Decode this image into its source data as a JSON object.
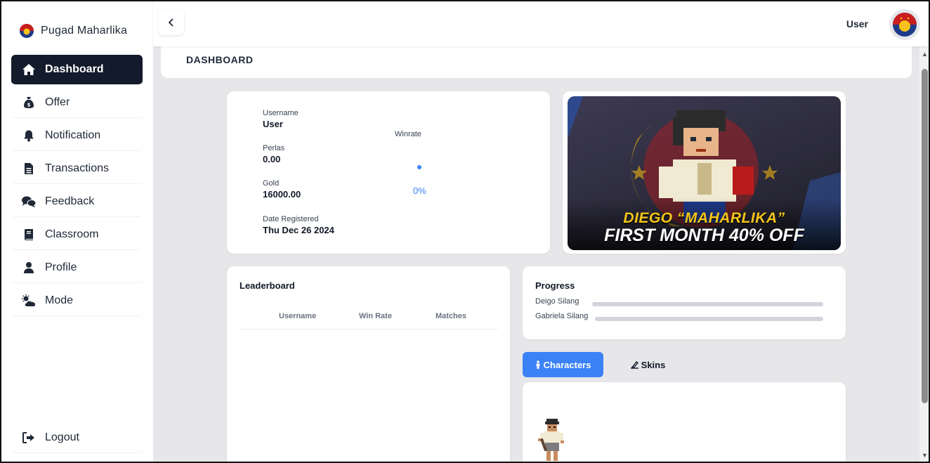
{
  "app": {
    "brand": "Pugad Maharlika",
    "logo_icon": "flag-emblem-icon"
  },
  "sidebar": {
    "items": [
      {
        "label": "Dashboard",
        "icon": "home-icon",
        "active": true
      },
      {
        "label": "Offer",
        "icon": "money-bag-icon",
        "active": false
      },
      {
        "label": "Notification",
        "icon": "bell-icon",
        "active": false
      },
      {
        "label": "Transactions",
        "icon": "document-icon",
        "active": false
      },
      {
        "label": "Feedback",
        "icon": "chat-bubbles-icon",
        "active": false
      },
      {
        "label": "Classroom",
        "icon": "book-icon",
        "active": false
      },
      {
        "label": "Profile",
        "icon": "user-icon",
        "active": false
      },
      {
        "label": "Mode",
        "icon": "cloud-sun-icon",
        "active": false
      }
    ],
    "logout": {
      "label": "Logout",
      "icon": "sign-out-icon"
    }
  },
  "topbar": {
    "back_icon": "chevron-left-icon",
    "user_label": "User"
  },
  "page": {
    "title": "DASHBOARD"
  },
  "stats": {
    "username_label": "Username",
    "username": "User",
    "perlas_label": "Perlas",
    "perlas": "0.00",
    "gold_label": "Gold",
    "gold": "16000.00",
    "date_label": "Date Registered",
    "date": "Thu Dec 26 2024",
    "winrate_label": "Winrate",
    "winrate": "0%"
  },
  "promo": {
    "line1": "DIEGO “MAHARLIKA”",
    "line2": "FIRST MONTH 40% OFF"
  },
  "leaderboard": {
    "title": "Leaderboard",
    "columns": [
      "Username",
      "Win Rate",
      "Matches"
    ],
    "rows": []
  },
  "progress": {
    "title": "Progress",
    "items": [
      {
        "name": "Deigo Silang",
        "fraction": 0
      },
      {
        "name": "Gabriela Silang",
        "fraction": 0
      }
    ]
  },
  "tabs": {
    "characters": "Characters",
    "skins": "Skins",
    "active": "characters"
  },
  "colors": {
    "sidebar_active": "#121a2b",
    "accent": "#3b82f6",
    "background": "#e7e7ea"
  }
}
